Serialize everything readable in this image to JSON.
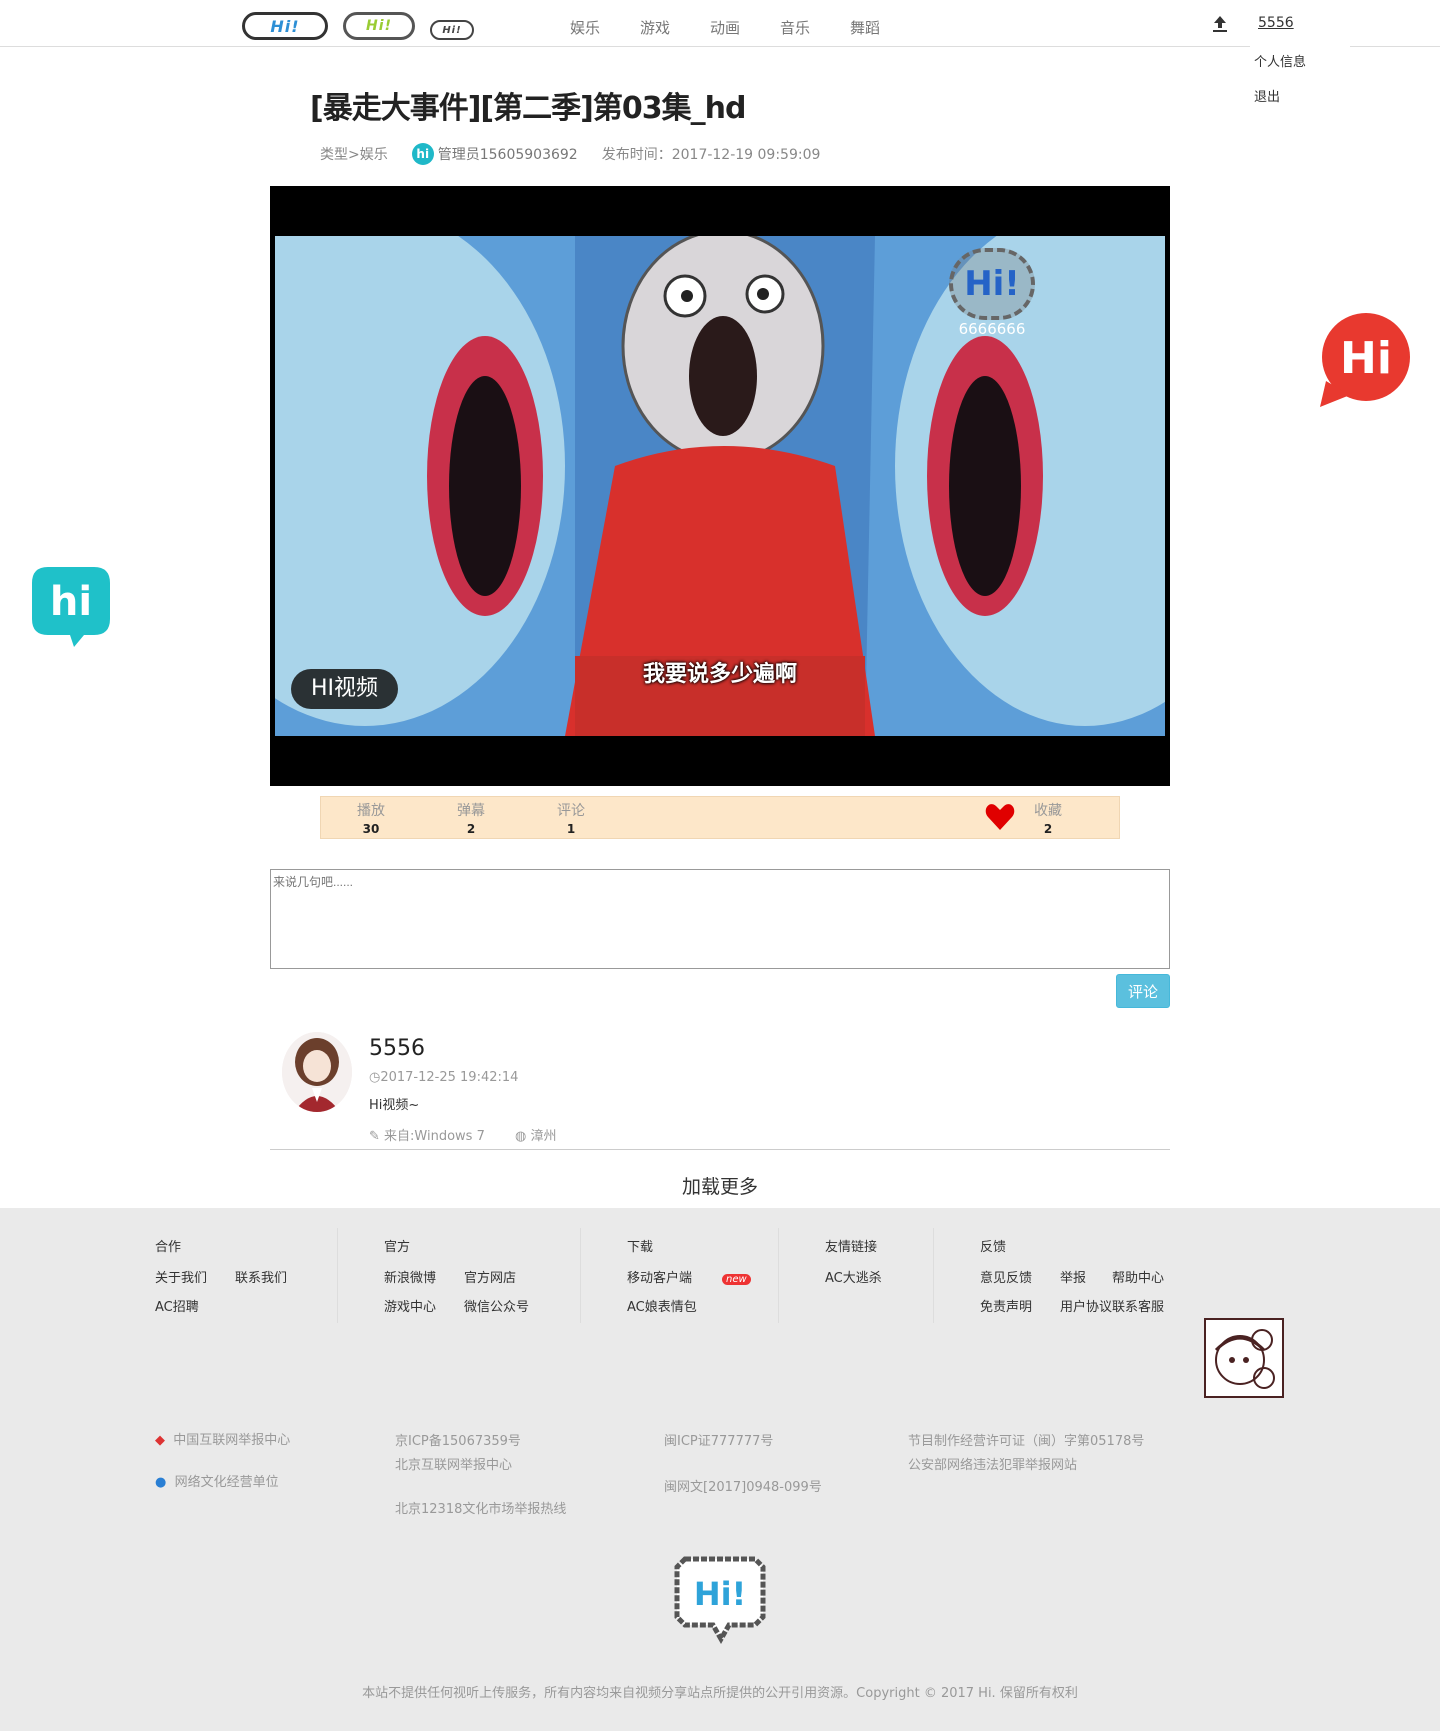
{
  "header": {
    "logos": [
      "Hi!",
      "Hi!",
      "Hi!"
    ],
    "nav": [
      "娱乐",
      "游戏",
      "动画",
      "音乐",
      "舞蹈"
    ],
    "user_name": "5556",
    "user_menu": [
      "个人信息",
      "退出"
    ]
  },
  "video": {
    "title": "[暴走大事件][第二季]第03集_hd",
    "category": "类型>娱乐",
    "author_badge": "hi",
    "author": "管理员15605903692",
    "publish_time": "发布时间：2017-12-19 09:59:09",
    "watermark_logo": "Hi!",
    "watermark_text": "6666666",
    "overlay_badge": "HI视频",
    "subtitle": "我要说多少遍啊"
  },
  "stats": {
    "play_label": "播放",
    "play_value": "30",
    "danmu_label": "弹幕",
    "danmu_value": "2",
    "comment_label": "评论",
    "comment_value": "1",
    "fav_label": "收藏",
    "fav_value": "2",
    "fav_icon": "heart-icon",
    "fav_color": "#e00000"
  },
  "comment_form": {
    "placeholder": "来说几句吧......",
    "submit": "评论"
  },
  "comments": [
    {
      "name": "5556",
      "time": "2017-12-25 19:42:14",
      "text": "Hi视频~",
      "from": "来自:Windows 7",
      "location": "漳州"
    }
  ],
  "load_more": "加载更多",
  "footer": {
    "cols": [
      {
        "title": "合作",
        "links": [
          "关于我们",
          "联系我们",
          "AC招聘"
        ]
      },
      {
        "title": "官方",
        "links": [
          "新浪微博",
          "官方网店",
          "游戏中心",
          "微信公众号"
        ]
      },
      {
        "title": "下载",
        "links": [
          "移动客户端",
          "AC娘表情包"
        ],
        "badge": "new"
      },
      {
        "title": "友情链接",
        "links": [
          "AC大逃杀"
        ]
      },
      {
        "title": "反馈",
        "links": [
          "意见反馈",
          "举报",
          "帮助中心",
          "免责声明",
          "用户协议",
          "联系客服"
        ]
      }
    ],
    "legal_left": [
      "中国互联网举报中心",
      "网络文化经营单位"
    ],
    "legal_col2": [
      "京ICP备15067359号",
      "北京互联网举报中心",
      "北京12318文化市场举报热线"
    ],
    "legal_col3": [
      "闽ICP证777777号",
      "闽网文[2017]0948-099号"
    ],
    "legal_col4": [
      "节目制作经营许可证（闽）字第05178号",
      "公安部网络违法犯罪举报网站"
    ],
    "logo": "Hi!",
    "copyright": "本站不提供任何视听上传服务，所有内容均来自视频分享站点所提供的公开引用资源。Copyright © 2017 Hi. 保留所有权利"
  },
  "side_bubbles": {
    "right": "Hi",
    "left": "hi"
  },
  "colors": {
    "accent": "#5bc0de",
    "stats_bg": "#fde7c9",
    "teal": "#1fb8c8",
    "red_bubble": "#e8392f"
  }
}
